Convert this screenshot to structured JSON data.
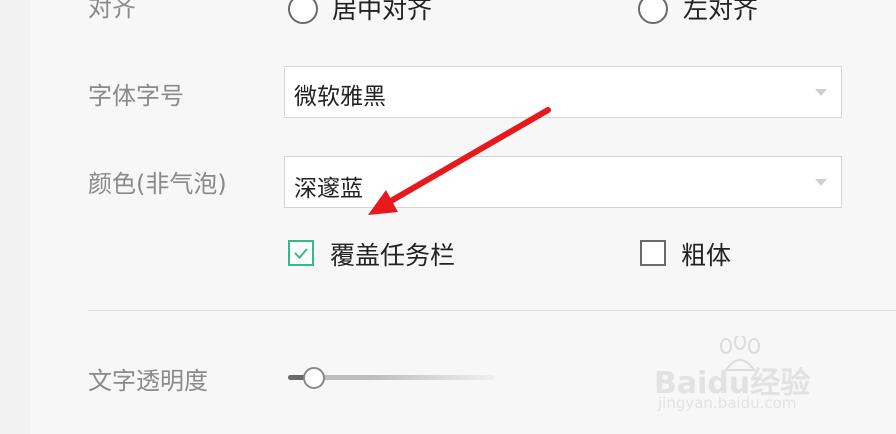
{
  "align": {
    "label": "对齐",
    "options": [
      {
        "label": "居中对齐",
        "selected": false
      },
      {
        "label": "左对齐",
        "selected": false
      }
    ]
  },
  "font": {
    "label": "字体字号",
    "value": "微软雅黑"
  },
  "color": {
    "label": "颜色(非气泡)",
    "value": "深邃蓝"
  },
  "checkboxes": [
    {
      "label": "覆盖任务栏",
      "checked": true
    },
    {
      "label": "粗体",
      "checked": false
    }
  ],
  "opacity": {
    "label": "文字透明度",
    "level": 0.1
  },
  "watermark": {
    "brand": "Baidu经验",
    "url": "jingyan.baidu.com"
  },
  "colors": {
    "accent_check": "#2fbf86",
    "arrow": "#e8191c"
  }
}
